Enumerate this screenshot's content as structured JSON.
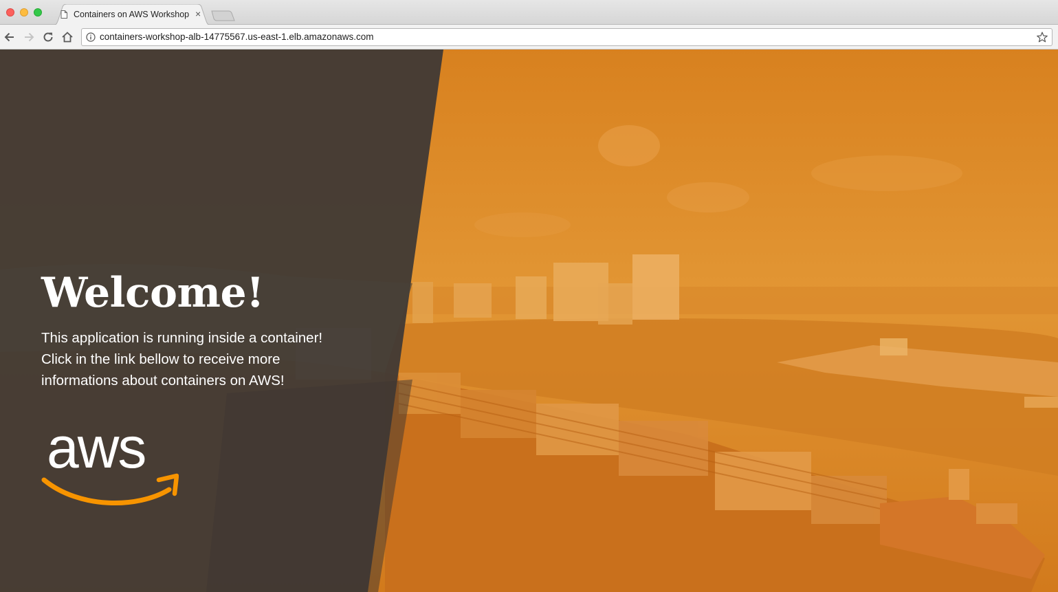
{
  "browser": {
    "tab_title": "Containers on AWS Workshop",
    "tab_close": "×",
    "url": "containers-workshop-alb-14775567.us-east-1.elb.amazonaws.com",
    "icons": [
      "back-icon",
      "forward-icon",
      "reload-icon",
      "home-icon",
      "info-icon",
      "star-icon",
      "page-icon",
      "close-icon"
    ]
  },
  "hero": {
    "heading": "Welcome!",
    "lines": [
      "This application is running inside a container!",
      "Click in the link bellow to receive more",
      "informations about containers on AWS!"
    ],
    "logo_text": "aws"
  },
  "colors": {
    "overlay_orange": "#d98324",
    "panel_dark": "#433b35",
    "aws_smile": "#f79400"
  }
}
